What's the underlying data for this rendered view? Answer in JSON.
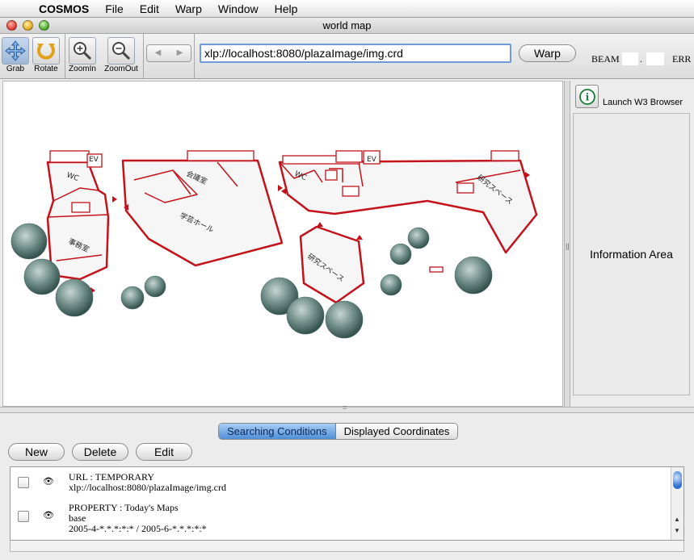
{
  "menubar": {
    "apple_icon": "apple-icon",
    "app": "COSMOS",
    "items": [
      "File",
      "Edit",
      "Warp",
      "Window",
      "Help"
    ]
  },
  "window": {
    "title": "world map"
  },
  "toolbar": {
    "tools": [
      {
        "label": "Grab",
        "icon": "move-arrows-icon"
      },
      {
        "label": "Rotate",
        "icon": "rotate-icon"
      },
      {
        "label": "ZoomIn",
        "icon": "zoom-in-icon"
      },
      {
        "label": "ZoomOut",
        "icon": "zoom-out-icon"
      }
    ],
    "url": "xlp://localhost:8080/plazaImage/img.crd",
    "warp_label": "Warp",
    "beam_label": "BEAM",
    "beam_dot": ".",
    "err_label": "ERR"
  },
  "map": {
    "labels": {
      "ev1": "EV",
      "ev2": "EV",
      "wc1": "WC",
      "wc2": "WC",
      "meeting": "会議室",
      "hall": "学芸ホール",
      "lab": "研究スペース",
      "office": "事務室",
      "research": "研究スペース"
    }
  },
  "side": {
    "launch_label": "Launch W3 Browser",
    "info_area": "Information Area"
  },
  "bottom": {
    "tabs": [
      "Searching Conditions",
      "Displayed Coordinates"
    ],
    "buttons": [
      "New",
      "Delete",
      "Edit"
    ],
    "rows": [
      {
        "line1": "URL : TEMPORARY",
        "line2": "xlp://localhost:8080/plazaImage/img.crd"
      },
      {
        "line1": "PROPERTY : Today's Maps",
        "line2": "base",
        "line3": "2005-4-*.*.*:*:* / 2005-6-*.*.*:*:*"
      }
    ]
  },
  "colors": {
    "wall": "#c4121a",
    "accent": "#4f8fd8"
  }
}
